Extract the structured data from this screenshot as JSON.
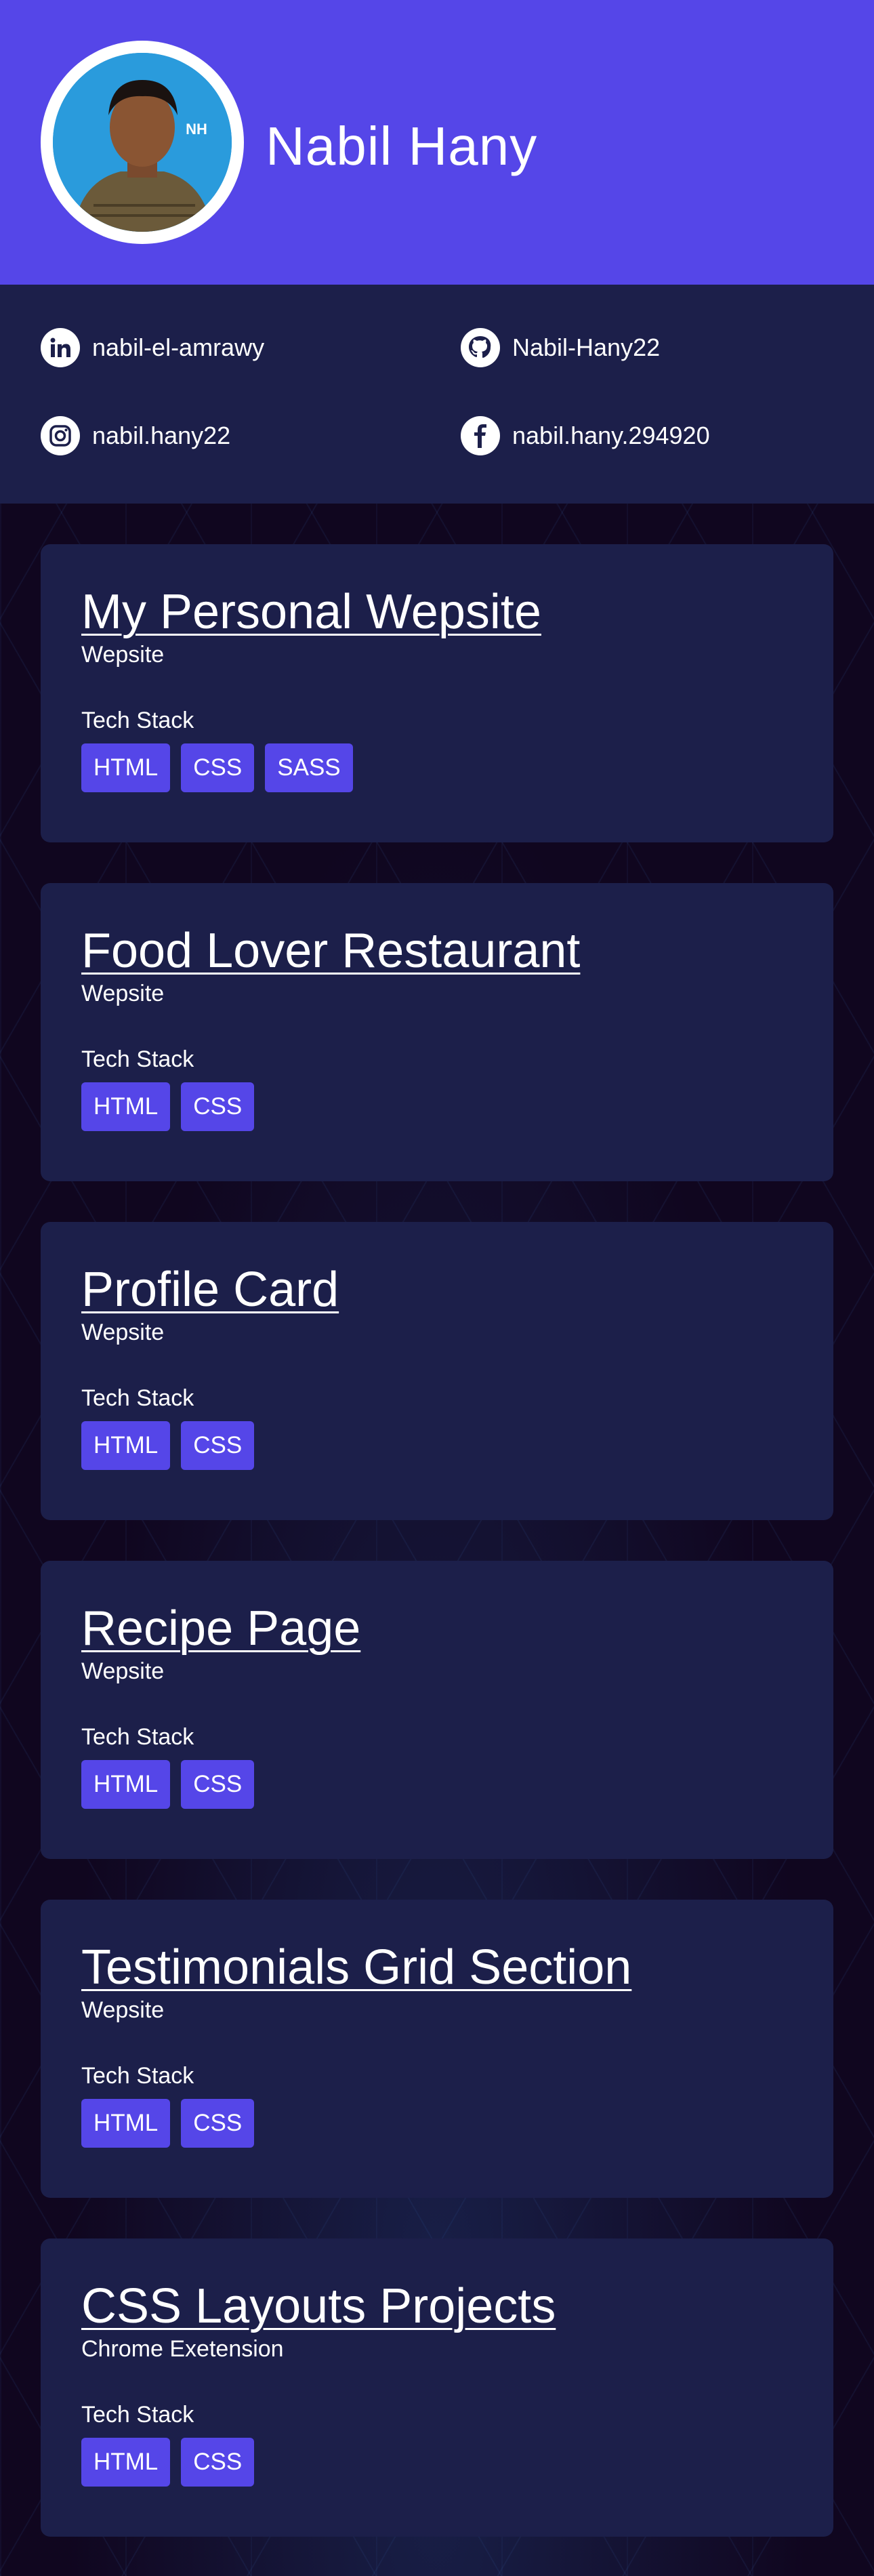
{
  "profile": {
    "name": "Nabil Hany",
    "avatar_logo": "NH"
  },
  "colors": {
    "header": "#5546e8",
    "panel": "#1c1f4a",
    "background": "#10061f",
    "tag": "#5546e8"
  },
  "socials": [
    {
      "icon": "linkedin-icon",
      "label": "nabil-el-amrawy"
    },
    {
      "icon": "github-icon",
      "label": "Nabil-Hany22"
    },
    {
      "icon": "instagram-icon",
      "label": "nabil.hany22"
    },
    {
      "icon": "facebook-icon",
      "label": "nabil.hany.294920"
    }
  ],
  "stack_label": "Tech Stack",
  "projects": [
    {
      "title": "My Personal Wepsite",
      "type": "Wepsite",
      "tags": [
        "HTML",
        "CSS",
        "SASS"
      ]
    },
    {
      "title": "Food Lover Restaurant",
      "type": "Wepsite",
      "tags": [
        "HTML",
        "CSS"
      ]
    },
    {
      "title": "Profile Card",
      "type": "Wepsite",
      "tags": [
        "HTML",
        "CSS"
      ]
    },
    {
      "title": "Recipe Page",
      "type": "Wepsite",
      "tags": [
        "HTML",
        "CSS"
      ]
    },
    {
      "title": "Testimonials Grid Section",
      "type": "Wepsite",
      "tags": [
        "HTML",
        "CSS"
      ]
    },
    {
      "title": "CSS Layouts Projects",
      "type": "Chrome Exetension",
      "tags": [
        "HTML",
        "CSS"
      ]
    }
  ]
}
